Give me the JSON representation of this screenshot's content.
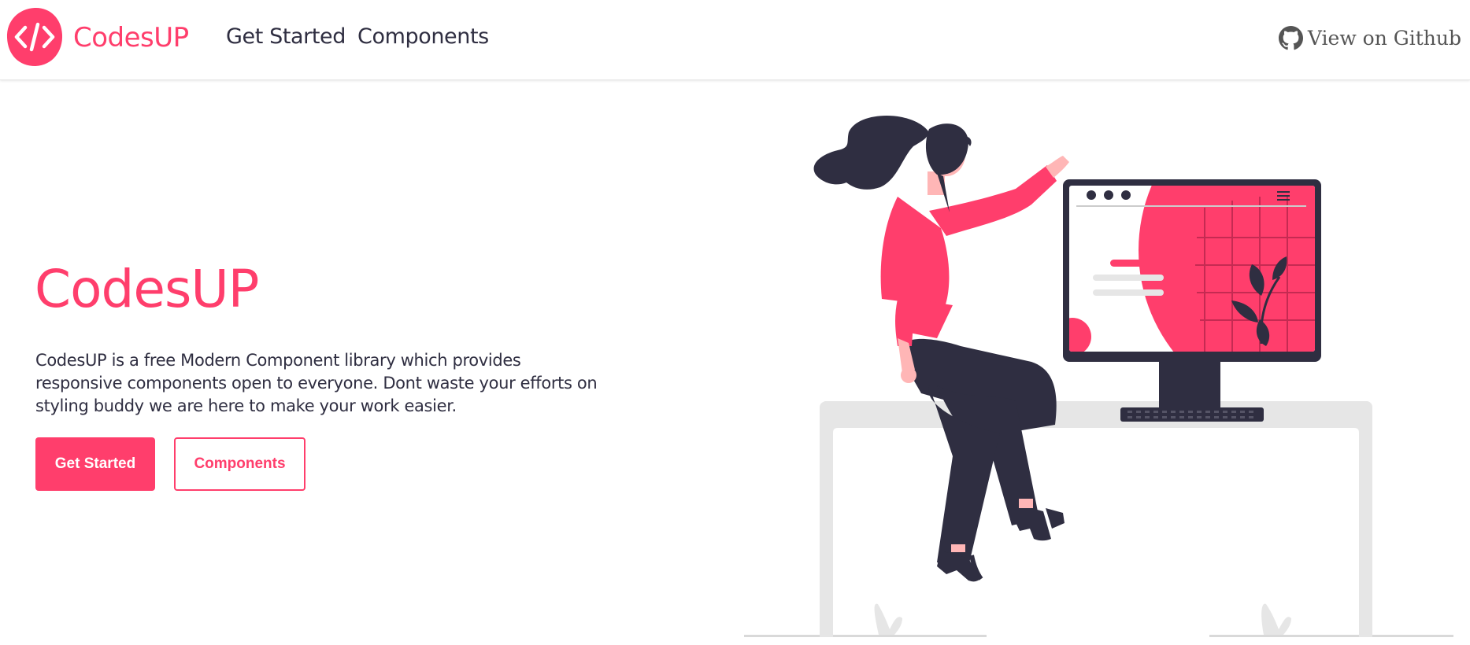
{
  "colors": {
    "brand": "#ff3e6c",
    "dark": "#2f2e41",
    "muted": "#555555",
    "light_gray": "#e6e6e6"
  },
  "header": {
    "logo_icon": "code-brackets-icon",
    "brand_name": "CodesUP",
    "nav": {
      "get_started": "Get Started",
      "components": "Components"
    },
    "github": {
      "icon": "github-icon",
      "label": "View on Github"
    }
  },
  "hero": {
    "title": "CodesUP",
    "description": "CodesUP is a free Modern Component library which provides responsive components open to everyone. Dont waste your efforts on styling buddy we are here to make your work easier.",
    "buttons": {
      "primary": "Get Started",
      "secondary": "Components"
    },
    "illustration": "woman-at-computer-illustration"
  }
}
